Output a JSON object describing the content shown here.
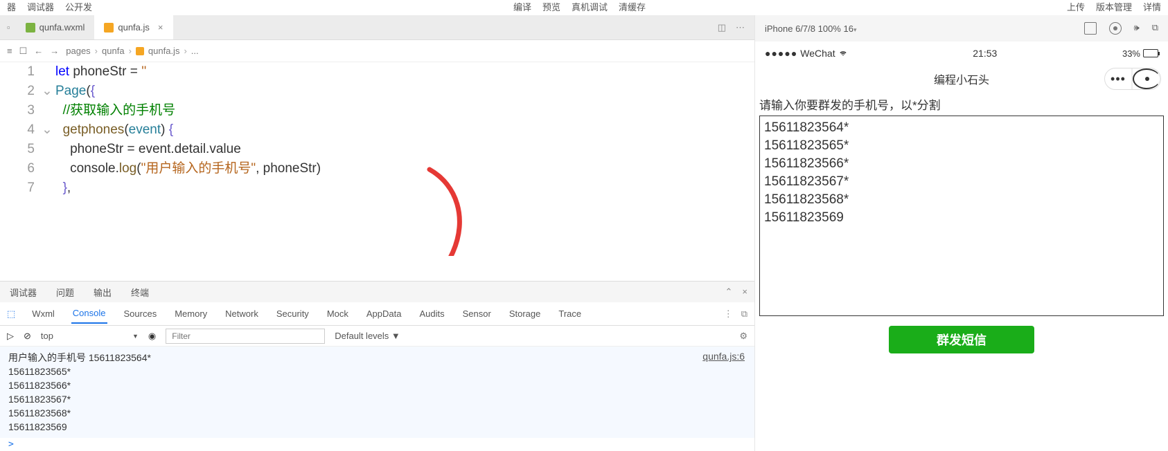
{
  "top_menu": {
    "left": [
      "器",
      "调试器",
      "公开发"
    ],
    "center": [
      "编译",
      "预览",
      "真机调试",
      "清缓存"
    ],
    "right": [
      "上传",
      "版本管理",
      "详情"
    ]
  },
  "tabs": [
    {
      "name": "qunfa.wxml",
      "type": "wxml",
      "active": false
    },
    {
      "name": "qunfa.js",
      "type": "js",
      "active": true
    }
  ],
  "breadcrumb": {
    "parts": [
      "pages",
      "qunfa",
      "qunfa.js",
      "..."
    ]
  },
  "code": {
    "lines": [
      1,
      2,
      3,
      4,
      5,
      6,
      7
    ],
    "line1": "let phoneStr = ''",
    "line2_a": "Page",
    "line2_b": "({",
    "line3": "//获取输入的手机号",
    "line4_a": "getphones",
    "line4_b": "(",
    "line4_c": "event",
    "line4_d": ") {",
    "line5": "phoneStr = event.detail.value",
    "line6_a": "console.",
    "line6_b": "log",
    "line6_c": "(",
    "line6_d": "\"用户输入的手机号\"",
    "line6_e": ", phoneStr)",
    "line7": "},"
  },
  "devtools": {
    "tabs1": [
      "调试器",
      "问题",
      "输出",
      "终端"
    ],
    "tabs2": [
      "Wxml",
      "Console",
      "Sources",
      "Memory",
      "Network",
      "Security",
      "Mock",
      "AppData",
      "Audits",
      "Sensor",
      "Storage",
      "Trace"
    ],
    "active_tab2": "Console",
    "context": "top",
    "filter_placeholder": "Filter",
    "levels": "Default levels ▼",
    "console_label": "用户输入的手机号",
    "console_lines": [
      "15611823564*",
      "15611823565*",
      "15611823566*",
      "15611823567*",
      "15611823568*",
      "15611823569"
    ],
    "source": "qunfa.js:6",
    "prompt": ">"
  },
  "simulator": {
    "device": "iPhone 6/7/8 100% 16",
    "caret": "▾",
    "status": {
      "carrier": "WeChat",
      "time": "21:53",
      "battery": "33%"
    },
    "nav_title": "编程小石头",
    "prompt": "请输入你要群发的手机号，以*分割",
    "textarea_value": "15611823564*\n15611823565*\n15611823566*\n15611823567*\n15611823568*\n15611823569",
    "button": "群发短信"
  }
}
